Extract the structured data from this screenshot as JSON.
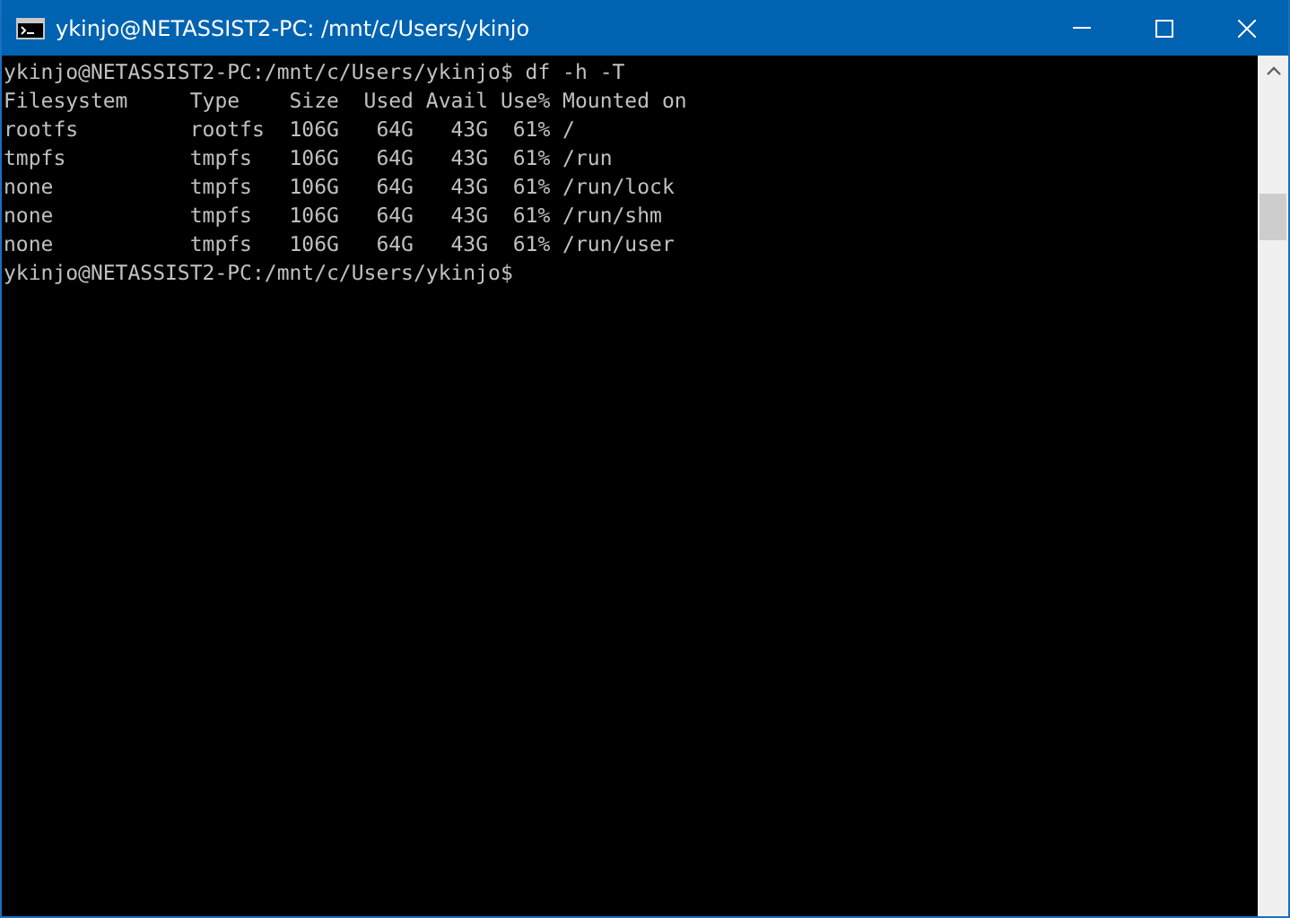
{
  "window": {
    "title": "ykinjo@NETASSIST2-PC: /mnt/c/Users/ykinjo"
  },
  "terminal": {
    "lines": [
      "ykinjo@NETASSIST2-PC:/mnt/c/Users/ykinjo$ df -h -T",
      "Filesystem     Type    Size  Used Avail Use% Mounted on",
      "rootfs         rootfs  106G   64G   43G  61% /",
      "tmpfs          tmpfs   106G   64G   43G  61% /run",
      "none           tmpfs   106G   64G   43G  61% /run/lock",
      "none           tmpfs   106G   64G   43G  61% /run/shm",
      "none           tmpfs   106G   64G   43G  61% /run/user",
      "ykinjo@NETASSIST2-PC:/mnt/c/Users/ykinjo$"
    ]
  }
}
